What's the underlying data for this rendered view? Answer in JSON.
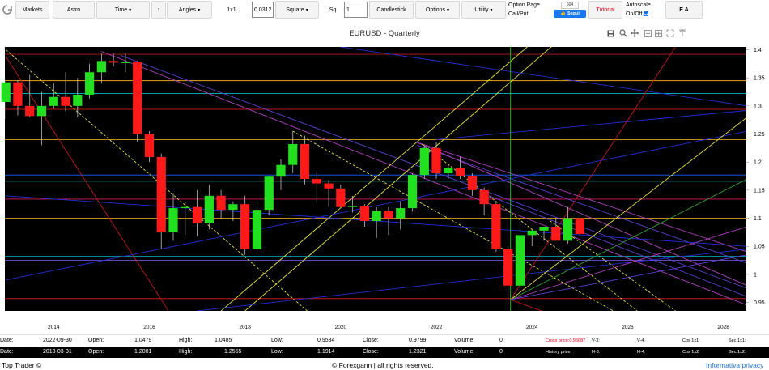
{
  "toolbar": {
    "markets": "Markets",
    "astro": "Astro",
    "time": "Time",
    "updown": "↕",
    "angles": "Angles",
    "ratio": "1x1",
    "ratio_value": "0.03124",
    "square": "Square",
    "sq_label": "Sq",
    "sq_value": "1",
    "candlestick": "Candlestick",
    "options": "Options",
    "utility": "Utility",
    "option_page": "Option Page",
    "call_put": "Call/Put",
    "fb_count": "604",
    "fb_follow": "Segui",
    "tutorial": "Tutorial",
    "autoscale": "Autoscale",
    "onoff": "On/Off",
    "ea": "E A"
  },
  "chart_title": "EURUSD - Quarterly",
  "chart_data": {
    "type": "candlestick",
    "title": "EURUSD - Quarterly",
    "x_ticks": [
      "2014",
      "2016",
      "2018",
      "2020",
      "2022",
      "2024",
      "2026",
      "2028"
    ],
    "y_ticks": [
      "0.95",
      "1",
      "1.05",
      "1.1",
      "1.15",
      "1.2",
      "1.25",
      "1.3",
      "1.35",
      "1.4"
    ],
    "ylim": [
      0.935,
      1.405
    ],
    "xlim": [
      2012.98,
      2028.48
    ],
    "candles": [
      {
        "t": 2013.0,
        "o": 1.307,
        "h": 1.345,
        "l": 1.277,
        "c": 1.342
      },
      {
        "t": 2013.25,
        "o": 1.342,
        "h": 1.346,
        "l": 1.283,
        "c": 1.3
      },
      {
        "t": 2013.5,
        "o": 1.3,
        "h": 1.355,
        "l": 1.28,
        "c": 1.282
      },
      {
        "t": 2013.75,
        "o": 1.282,
        "h": 1.325,
        "l": 1.23,
        "c": 1.3
      },
      {
        "t": 2014.0,
        "o": 1.3,
        "h": 1.34,
        "l": 1.295,
        "c": 1.316
      },
      {
        "t": 2014.25,
        "o": 1.316,
        "h": 1.36,
        "l": 1.29,
        "c": 1.3
      },
      {
        "t": 2014.5,
        "o": 1.3,
        "h": 1.35,
        "l": 1.28,
        "c": 1.32
      },
      {
        "t": 2014.75,
        "o": 1.32,
        "h": 1.375,
        "l": 1.313,
        "c": 1.36
      },
      {
        "t": 2015.0,
        "o": 1.36,
        "h": 1.393,
        "l": 1.34,
        "c": 1.38
      },
      {
        "t": 2015.25,
        "o": 1.38,
        "h": 1.393,
        "l": 1.37,
        "c": 1.377
      },
      {
        "t": 2015.5,
        "o": 1.377,
        "h": 1.395,
        "l": 1.36,
        "c": 1.378
      },
      {
        "t": 2015.75,
        "o": 1.378,
        "h": 1.38,
        "l": 1.235,
        "c": 1.25
      },
      {
        "t": 2016.0,
        "o": 1.25,
        "h": 1.255,
        "l": 1.2,
        "c": 1.209
      },
      {
        "t": 2016.25,
        "o": 1.209,
        "h": 1.215,
        "l": 1.045,
        "c": 1.075
      },
      {
        "t": 2016.5,
        "o": 1.075,
        "h": 1.145,
        "l": 1.06,
        "c": 1.118
      },
      {
        "t": 2016.75,
        "o": 1.118,
        "h": 1.13,
        "l": 1.07,
        "c": 1.12
      },
      {
        "t": 2017.0,
        "o": 1.12,
        "h": 1.15,
        "l": 1.068,
        "c": 1.091
      },
      {
        "t": 2017.25,
        "o": 1.091,
        "h": 1.16,
        "l": 1.08,
        "c": 1.14
      },
      {
        "t": 2017.5,
        "o": 1.14,
        "h": 1.15,
        "l": 1.1,
        "c": 1.115
      },
      {
        "t": 2017.75,
        "o": 1.115,
        "h": 1.13,
        "l": 1.095,
        "c": 1.125
      },
      {
        "t": 2018.0,
        "o": 1.125,
        "h": 1.14,
        "l": 1.035,
        "c": 1.045
      },
      {
        "t": 2018.25,
        "o": 1.045,
        "h": 1.128,
        "l": 1.035,
        "c": 1.115
      },
      {
        "t": 2018.5,
        "o": 1.115,
        "h": 1.175,
        "l": 1.105,
        "c": 1.174
      },
      {
        "t": 2018.75,
        "o": 1.174,
        "h": 1.205,
        "l": 1.15,
        "c": 1.195
      },
      {
        "t": 2019.0,
        "o": 1.195,
        "h": 1.255,
        "l": 1.18,
        "c": 1.232
      },
      {
        "t": 2019.25,
        "o": 1.232,
        "h": 1.247,
        "l": 1.16,
        "c": 1.17
      },
      {
        "t": 2019.5,
        "o": 1.17,
        "h": 1.182,
        "l": 1.13,
        "c": 1.162
      },
      {
        "t": 2019.75,
        "o": 1.162,
        "h": 1.168,
        "l": 1.12,
        "c": 1.153
      },
      {
        "t": 2020.0,
        "o": 1.153,
        "h": 1.16,
        "l": 1.12,
        "c": 1.12
      },
      {
        "t": 2020.25,
        "o": 1.12,
        "h": 1.14,
        "l": 1.11,
        "c": 1.122
      },
      {
        "t": 2020.5,
        "o": 1.122,
        "h": 1.125,
        "l": 1.085,
        "c": 1.095
      },
      {
        "t": 2020.75,
        "o": 1.095,
        "h": 1.12,
        "l": 1.065,
        "c": 1.113
      },
      {
        "t": 2021.0,
        "o": 1.113,
        "h": 1.12,
        "l": 1.07,
        "c": 1.1
      },
      {
        "t": 2021.25,
        "o": 1.1,
        "h": 1.13,
        "l": 1.08,
        "c": 1.118
      },
      {
        "t": 2021.5,
        "o": 1.118,
        "h": 1.18,
        "l": 1.112,
        "c": 1.177
      },
      {
        "t": 2021.75,
        "o": 1.177,
        "h": 1.23,
        "l": 1.17,
        "c": 1.225
      },
      {
        "t": 2022.0,
        "o": 1.225,
        "h": 1.235,
        "l": 1.17,
        "c": 1.18
      },
      {
        "t": 2022.25,
        "o": 1.18,
        "h": 1.195,
        "l": 1.17,
        "c": 1.19
      },
      {
        "t": 2022.5,
        "o": 1.19,
        "h": 1.21,
        "l": 1.17,
        "c": 1.175
      },
      {
        "t": 2022.75,
        "o": 1.175,
        "h": 1.18,
        "l": 1.14,
        "c": 1.15
      },
      {
        "t": 2023.0,
        "o": 1.15,
        "h": 1.155,
        "l": 1.105,
        "c": 1.125
      },
      {
        "t": 2023.25,
        "o": 1.125,
        "h": 1.13,
        "l": 1.04,
        "c": 1.045
      },
      {
        "t": 2023.5,
        "o": 1.045,
        "h": 1.05,
        "l": 0.953,
        "c": 0.98
      },
      {
        "t": 2023.75,
        "o": 0.98,
        "h": 1.08,
        "l": 0.96,
        "c": 1.07
      },
      {
        "t": 2024.0,
        "o": 1.07,
        "h": 1.08,
        "l": 1.05,
        "c": 1.078
      },
      {
        "t": 2024.25,
        "o": 1.078,
        "h": 1.085,
        "l": 1.06,
        "c": 1.085
      },
      {
        "t": 2024.5,
        "o": 1.085,
        "h": 1.1,
        "l": 1.06,
        "c": 1.06
      },
      {
        "t": 2024.75,
        "o": 1.06,
        "h": 1.12,
        "l": 1.055,
        "c": 1.1
      },
      {
        "t": 2025.0,
        "o": 1.1,
        "h": 1.105,
        "l": 1.065,
        "c": 1.072
      }
    ],
    "hlines": [
      {
        "y": 1.392,
        "color": "#c01818"
      },
      {
        "y": 1.345,
        "color": "#f0a020"
      },
      {
        "y": 1.322,
        "color": "#00b8c8"
      },
      {
        "y": 1.294,
        "color": "#c01818"
      },
      {
        "y": 1.24,
        "color": "#e0a020"
      },
      {
        "y": 1.177,
        "color": "#1a60ff"
      },
      {
        "y": 1.166,
        "color": "#00b8c8"
      },
      {
        "y": 1.134,
        "color": "#d02060"
      },
      {
        "y": 1.1,
        "color": "#e0a020"
      },
      {
        "y": 1.032,
        "color": "#00b8c8"
      },
      {
        "y": 1.025,
        "color": "#7050d0"
      },
      {
        "y": 0.957,
        "color": "#c01818"
      }
    ],
    "vline_x": 2023.55,
    "lines": [
      {
        "x1": 2013.0,
        "y1": 1.388,
        "x2": 2016.4,
        "y2": 0.935,
        "color": "#c01818"
      },
      {
        "x1": 2013.0,
        "y1": 1.4,
        "x2": 2019.3,
        "y2": 0.935,
        "color": "#e8e040",
        "dash": true
      },
      {
        "x1": 2015.0,
        "y1": 1.397,
        "x2": 2028.5,
        "y2": 0.945,
        "color": "#b040c0"
      },
      {
        "x1": 2015.4,
        "y1": 1.39,
        "x2": 2028.5,
        "y2": 0.975,
        "color": "#6040d0"
      },
      {
        "x1": 2019.0,
        "y1": 1.255,
        "x2": 2025.7,
        "y2": 0.935,
        "color": "#e8e040",
        "dash": true
      },
      {
        "x1": 2017.5,
        "y1": 0.935,
        "x2": 2023.9,
        "y2": 1.405,
        "color": "#e8e040"
      },
      {
        "x1": 2018.0,
        "y1": 0.935,
        "x2": 2024.4,
        "y2": 1.405,
        "color": "#e8e040"
      },
      {
        "x1": 2021.6,
        "y1": 1.235,
        "x2": 2028.5,
        "y2": 1.04,
        "color": "#b040c0"
      },
      {
        "x1": 2021.6,
        "y1": 1.23,
        "x2": 2028.5,
        "y2": 1.02,
        "color": "#6040d0"
      },
      {
        "x1": 2021.6,
        "y1": 1.235,
        "x2": 2028.5,
        "y2": 0.98,
        "color": "#b040c0"
      },
      {
        "x1": 2021.7,
        "y1": 1.232,
        "x2": 2026.2,
        "y2": 0.935,
        "color": "#e8e040",
        "dash": true
      },
      {
        "x1": 2013.0,
        "y1": 0.99,
        "x2": 2028.5,
        "y2": 1.255,
        "color": "#2030d0"
      },
      {
        "x1": 2013.0,
        "y1": 1.14,
        "x2": 2028.5,
        "y2": 1.05,
        "color": "#2030d0"
      },
      {
        "x1": 2017.0,
        "y1": 0.935,
        "x2": 2028.5,
        "y2": 1.045,
        "color": "#2030d0"
      },
      {
        "x1": 2022.0,
        "y1": 1.24,
        "x2": 2028.5,
        "y2": 1.292,
        "color": "#2030d0"
      },
      {
        "x1": 2020.0,
        "y1": 1.405,
        "x2": 2028.5,
        "y2": 1.3,
        "color": "#2030d0"
      },
      {
        "x1": 2023.55,
        "y1": 0.955,
        "x2": 2027.0,
        "y2": 1.405,
        "color": "#c01818"
      },
      {
        "x1": 2023.55,
        "y1": 0.955,
        "x2": 2028.5,
        "y2": 1.28,
        "color": "#e8e040"
      },
      {
        "x1": 2023.55,
        "y1": 0.955,
        "x2": 2028.5,
        "y2": 1.17,
        "color": "#30a030"
      },
      {
        "x1": 2023.55,
        "y1": 0.955,
        "x2": 2028.5,
        "y2": 1.085,
        "color": "#b040c0"
      },
      {
        "x1": 2023.55,
        "y1": 0.955,
        "x2": 2028.5,
        "y2": 1.035,
        "color": "#6040d0"
      },
      {
        "x1": 2023.55,
        "y1": 0.955,
        "x2": 2024.2,
        "y2": 0.935,
        "color": "#c01818"
      },
      {
        "x1": 2024.3,
        "y1": 1.1,
        "x2": 2027.0,
        "y2": 0.935,
        "color": "#e8e040",
        "dash": true
      },
      {
        "x1": 2023.1,
        "y1": 1.14,
        "x2": 2028.5,
        "y2": 0.96,
        "color": "#6040d0"
      }
    ]
  },
  "row1": {
    "date_label": "Date:",
    "date": "2022-09-30",
    "open_label": "Open:",
    "open": "1.0479",
    "high_label": "High:",
    "high": "1.0485",
    "low_label": "Low:",
    "low": "0.9534",
    "close_label": "Close:",
    "close": "0.9799",
    "volume_label": "Volume:",
    "volume": "0",
    "cross_price": "Cross price:0.95687",
    "v3": "V-3:",
    "v4": "V-4:",
    "cos1": "Cos 1x1:",
    "sec1": "Sec 1x1:"
  },
  "row2": {
    "date_label": "Date:",
    "date": "2018-03-31",
    "open_label": "Open:",
    "open": "1.2001",
    "high_label": "High:",
    "high": "1.2555",
    "low_label": "Low:",
    "low": "1.1914",
    "close_label": "Close:",
    "close": "1.2321",
    "volume_label": "Volume:",
    "volume": "0",
    "history_price": "History price:",
    "h3": "H-3:",
    "h4": "H-4:",
    "cos2": "Cos 1x2:",
    "sec2": "Sec 1x2:"
  },
  "footer": {
    "left": "Top Trader ©",
    "center": "© Forexgann | all rights reserved.",
    "right": "Informativa privacy"
  },
  "colors": {
    "bull": "#22e020",
    "bear": "#ff1a1a",
    "chart_bg": "#000000",
    "footer_link": "#1d6fe0"
  },
  "icons": [
    "logo-refresh-icon",
    "save-icon",
    "zoom-in-icon",
    "pan-icon",
    "zoom-minus-icon",
    "zoom-plus-icon",
    "reset-axes-icon"
  ]
}
